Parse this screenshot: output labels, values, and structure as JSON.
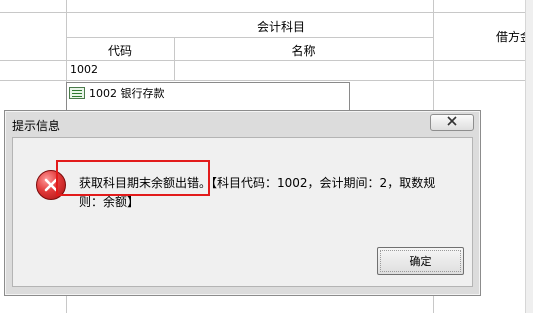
{
  "table": {
    "group_header": "会计科目",
    "col_code": "代码",
    "col_name": "名称",
    "col_debit": "借方金",
    "row_code": "1002"
  },
  "lookup": {
    "item_text": "1002 银行存款",
    "item_icon": "ledger-icon"
  },
  "dialog": {
    "title": "提示信息",
    "close_icon": "close-icon",
    "error_icon": "error-icon",
    "message_main": "获取科目期末余额出错。",
    "message_detail": "【科目代码：1002，会计期间：2，取数规则：余额】",
    "ok_label": "确定",
    "highlight_color": "#e21b1b"
  }
}
